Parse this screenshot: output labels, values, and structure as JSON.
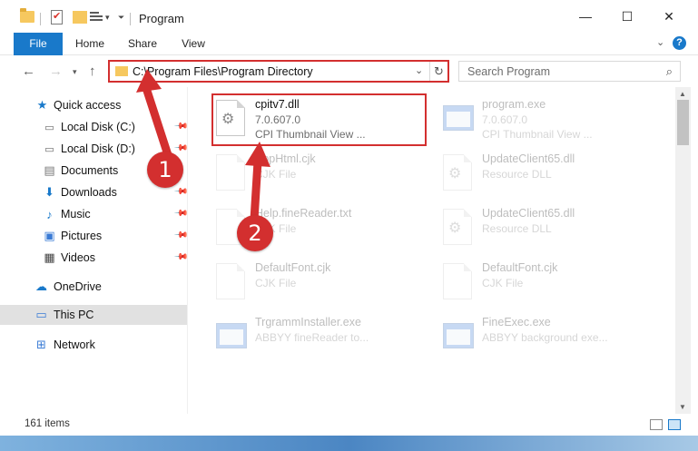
{
  "window": {
    "title": "Program",
    "minimize_glyph": "—",
    "maximize_glyph": "☐",
    "close_glyph": "✕"
  },
  "ribbon": {
    "tabs": [
      "File",
      "Home",
      "Share",
      "View"
    ],
    "help": "?"
  },
  "address": {
    "path": "C:\\Program Files\\Program Directory",
    "search_placeholder": "Search Program"
  },
  "sidebar": {
    "items": [
      {
        "label": "Quick access",
        "icon": "star-icon"
      },
      {
        "label": "Local Disk (C:)",
        "icon": "drive-icon"
      },
      {
        "label": "Local Disk (D:)",
        "icon": "drive-icon"
      },
      {
        "label": "Documents",
        "icon": "documents-icon"
      },
      {
        "label": "Downloads",
        "icon": "download-icon"
      },
      {
        "label": "Music",
        "icon": "music-icon"
      },
      {
        "label": "Pictures",
        "icon": "pictures-icon"
      },
      {
        "label": "Videos",
        "icon": "videos-icon"
      },
      {
        "label": "OneDrive",
        "icon": "cloud-icon"
      },
      {
        "label": "This PC",
        "icon": "computer-icon"
      },
      {
        "label": "Network",
        "icon": "network-icon"
      }
    ]
  },
  "files": [
    {
      "name": "cpitv7.dll",
      "line2": "7.0.607.0",
      "line3": "CPI Thumbnail View ...",
      "icon": "gear-file-icon"
    },
    {
      "name": "program.exe",
      "line2": "7.0.607.0",
      "line3": "CPI Thumbnail View ...",
      "icon": "exe-icon"
    },
    {
      "name": "AppHtml.cjk",
      "line2": "CJK File",
      "icon": "blank-file-icon"
    },
    {
      "name": "UpdateClient65.dll",
      "line2": "Resource DLL",
      "icon": "gear-file-icon"
    },
    {
      "name": "Help.fineReader.txt",
      "line2": "CJK File",
      "icon": "blank-file-icon"
    },
    {
      "name": "UpdateClient65.dll",
      "line2": "Resource DLL",
      "icon": "gear-file-icon"
    },
    {
      "name": "DefaultFont.cjk",
      "line2": "CJK File",
      "icon": "blank-file-icon"
    },
    {
      "name": "DefaultFont.cjk",
      "line2": "CJK File",
      "icon": "blank-file-icon"
    },
    {
      "name": "TrgrammInstaller.exe",
      "line2": "ABBYY fineReader to...",
      "icon": "exe-icon"
    },
    {
      "name": "FineExec.exe",
      "line2": "ABBYY background exe...",
      "icon": "exe-icon"
    }
  ],
  "status": {
    "count": "161 items"
  },
  "annotations": {
    "step1": "1",
    "step2": "2"
  },
  "colors": {
    "accent": "#1979ca",
    "annotation_red": "#d32f2f",
    "selection": "#e1e1e1"
  }
}
